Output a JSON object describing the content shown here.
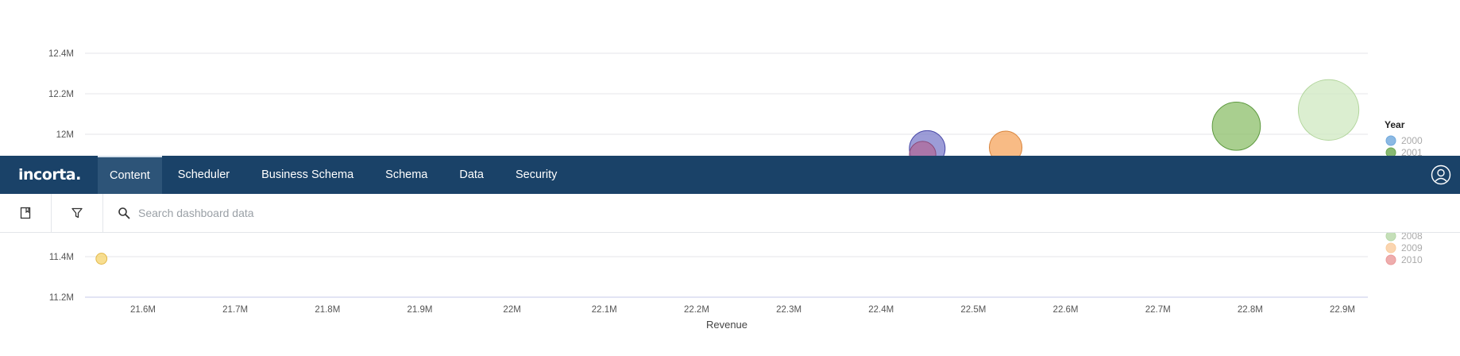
{
  "nav": {
    "logo": "incorta.",
    "items": [
      {
        "label": "Content",
        "active": true
      },
      {
        "label": "Scheduler",
        "active": false
      },
      {
        "label": "Business Schema",
        "active": false
      },
      {
        "label": "Schema",
        "active": false
      },
      {
        "label": "Data",
        "active": false
      },
      {
        "label": "Security",
        "active": false
      }
    ]
  },
  "toolbar": {
    "bookmark_icon": "bookmark-icon",
    "filter_icon": "filter-icon",
    "search_icon": "search-icon",
    "search_placeholder": "Search dashboard data"
  },
  "chart_data": {
    "type": "scatter",
    "xlabel": "Revenue",
    "ylabel": "",
    "x_ticks": [
      "21.6M",
      "21.7M",
      "21.8M",
      "21.9M",
      "22M",
      "22.1M",
      "22.2M",
      "22.3M",
      "22.4M",
      "22.5M",
      "22.6M",
      "22.7M",
      "22.8M",
      "22.9M"
    ],
    "y_ticks_visible": [
      "12.4M",
      "12.2M",
      "12M",
      "11.4M",
      "11.2M"
    ],
    "xlim": [
      21540000,
      22930000
    ],
    "legend": {
      "title": "Year",
      "placement": "right",
      "visible_entries": [
        {
          "label": "2000",
          "color": "#6fa8dc"
        },
        {
          "label": "2001",
          "color": "#6aa84f"
        },
        {
          "label": "2008",
          "color": "#b6d7a8"
        },
        {
          "label": "2009",
          "color": "#f9cb9c"
        },
        {
          "label": "2010",
          "color": "#ea9999"
        }
      ]
    },
    "points": [
      {
        "x": 22450000,
        "y": 11930000,
        "size": 10,
        "color": "#7b7bc9",
        "stroke": "#4a4aa8"
      },
      {
        "x": 22445000,
        "y": 11900000,
        "size": 7,
        "color": "#b06a9a",
        "stroke": "#8a4a7a"
      },
      {
        "x": 22535000,
        "y": 11935000,
        "size": 9,
        "color": "#f6a45c",
        "stroke": "#d8843c"
      },
      {
        "x": 22785000,
        "y": 12040000,
        "size": 14,
        "color": "#8cbf6a",
        "stroke": "#5e9a40"
      },
      {
        "x": 22885000,
        "y": 12120000,
        "size": 18,
        "color": "#cfe8c0",
        "stroke": "#b2d59c"
      },
      {
        "x": 21555000,
        "y": 11390000,
        "size": 2,
        "color": "#f6d36b",
        "stroke": "#e2b84a"
      }
    ]
  }
}
